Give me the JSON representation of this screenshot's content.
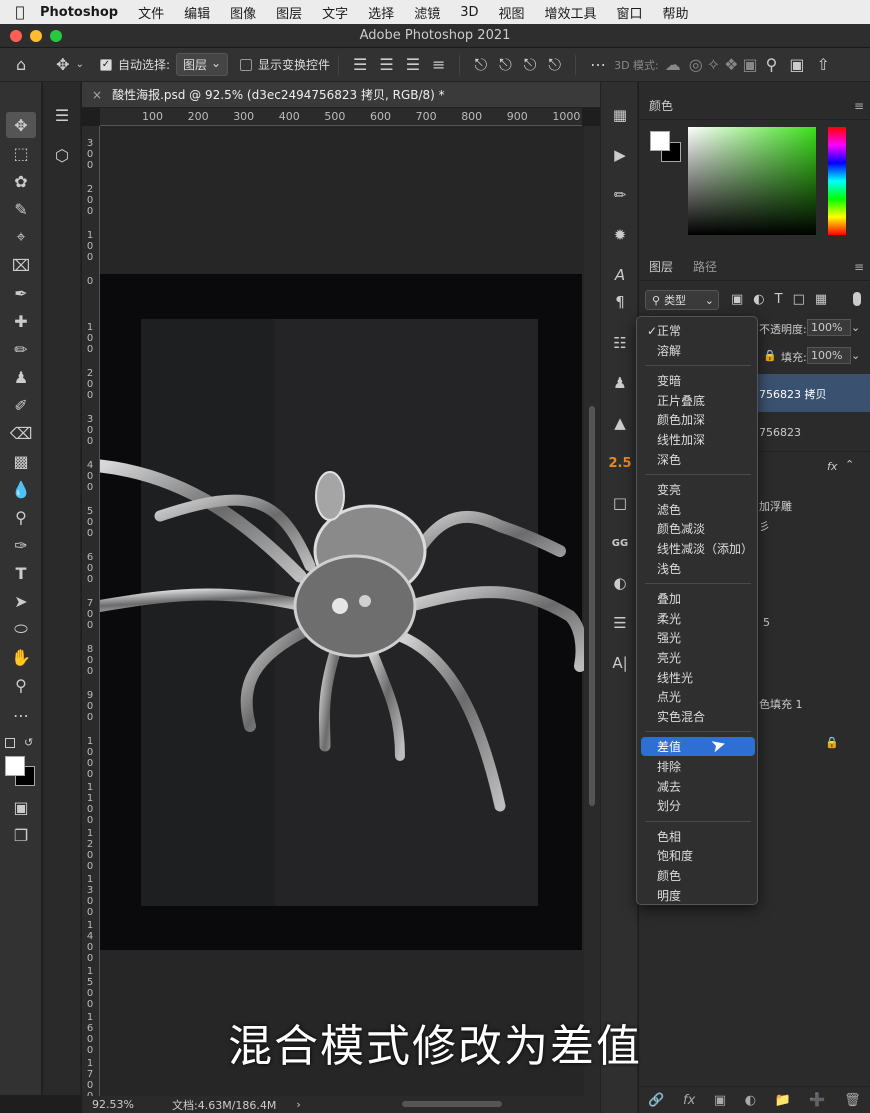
{
  "menubar": {
    "app": "Photoshop",
    "items": [
      "文件",
      "编辑",
      "图像",
      "图层",
      "文字",
      "选择",
      "滤镜",
      "3D",
      "视图",
      "增效工具",
      "窗口",
      "帮助"
    ]
  },
  "window": {
    "title": "Adobe Photoshop 2021"
  },
  "options": {
    "auto_select_label": "自动选择:",
    "auto_select_value": "图层",
    "show_transform_label": "显示变换控件",
    "mode_3d_label": "3D 模式:"
  },
  "document": {
    "tab_title": "酸性海报.psd @ 92.5% (d3ec2494756823 拷贝, RGB/8) *"
  },
  "ruler": {
    "h_ticks": [
      "100",
      "200",
      "300",
      "400",
      "500",
      "600",
      "700",
      "800",
      "900",
      "1000"
    ],
    "v_ticks": [
      "3\n0\n0",
      "2\n0\n0",
      "1\n0\n0",
      "0",
      "1\n0\n0",
      "2\n0\n0",
      "3\n0\n0",
      "4\n0\n0",
      "5\n0\n0",
      "6\n0\n0",
      "7\n0\n0",
      "8\n0\n0",
      "9\n0\n0",
      "1\n0\n0\n0",
      "1\n1\n0\n0",
      "1\n2\n0\n0",
      "1\n3\n0\n0",
      "1\n4\n0\n0",
      "1\n5\n0\n0",
      "1\n6\n0\n0",
      "1\n7\n0\n0"
    ]
  },
  "status": {
    "zoom": "92.53%",
    "doc": "文档:4.63M/186.4M",
    "arrow": "›"
  },
  "color_panel": {
    "tab": "颜色",
    "fg_color": "#ffffff",
    "bg_color": "#000000"
  },
  "layers_panel": {
    "tabs": [
      "图层",
      "路径"
    ],
    "filter_label": "类型",
    "opacity_label": "不透明度:",
    "opacity_value": "100%",
    "fill_label": "填充:",
    "fill_value": "100%",
    "rows": [
      {
        "label": "756823 拷贝"
      },
      {
        "label": "756823"
      },
      {
        "label": "fx"
      },
      {
        "label": "加浮雕"
      },
      {
        "label": "彡"
      },
      {
        "label": "5"
      },
      {
        "label": "色填充 1"
      }
    ]
  },
  "side_icons": {
    "value_25": "2.5"
  },
  "blend_menu": {
    "groups": [
      [
        "正常",
        "溶解"
      ],
      [
        "变暗",
        "正片叠底",
        "颜色加深",
        "线性加深",
        "深色"
      ],
      [
        "变亮",
        "滤色",
        "颜色减淡",
        "线性减淡（添加）",
        "浅色"
      ],
      [
        "叠加",
        "柔光",
        "强光",
        "亮光",
        "线性光",
        "点光",
        "实色混合"
      ],
      [
        "差值",
        "排除",
        "减去",
        "划分"
      ],
      [
        "色相",
        "饱和度",
        "颜色",
        "明度"
      ]
    ],
    "checked": "正常",
    "selected": "差值"
  },
  "caption": "混合模式修改为差值"
}
